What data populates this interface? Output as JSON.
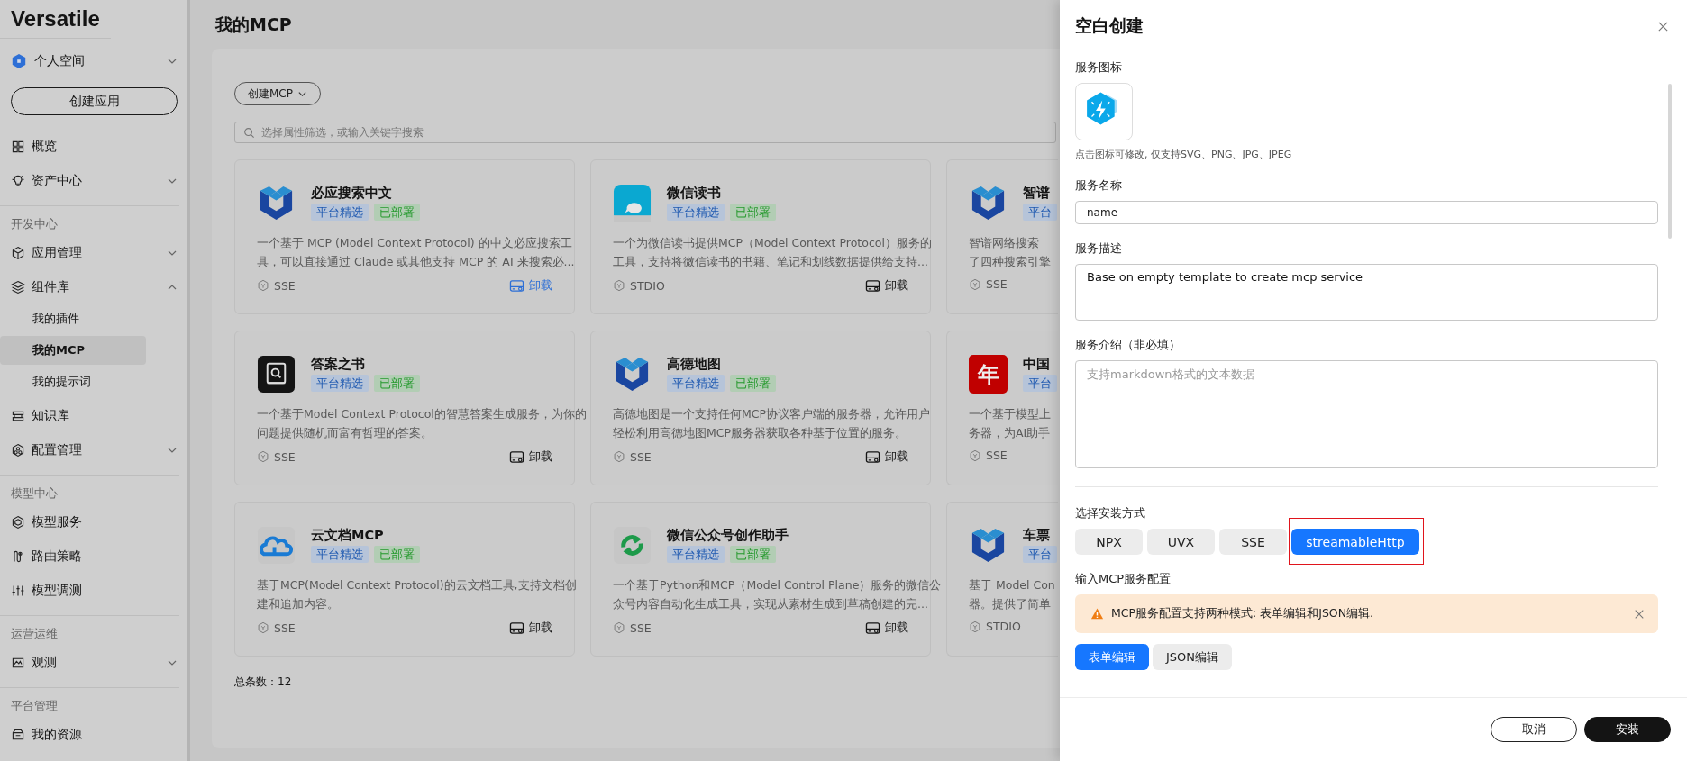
{
  "sidebar": {
    "logo": "Versatile",
    "workspace": {
      "label": "个人空间",
      "expanded": false
    },
    "create_button": "创建应用",
    "groups": [
      {
        "items": [
          {
            "label": "概览"
          },
          {
            "label": "资产中心",
            "expanded": false
          }
        ]
      },
      {
        "heading": "开发中心",
        "items": [
          {
            "label": "应用管理",
            "expanded": false
          },
          {
            "label": "组件库",
            "expanded": true,
            "children": [
              {
                "label": "我的插件",
                "selected": false
              },
              {
                "label": "我的MCP",
                "selected": true
              },
              {
                "label": "我的提示词",
                "selected": false
              }
            ]
          },
          {
            "label": "知识库"
          },
          {
            "label": "配置管理",
            "expanded": false
          }
        ]
      },
      {
        "heading": "模型中心",
        "items": [
          {
            "label": "模型服务"
          },
          {
            "label": "路由策略"
          },
          {
            "label": "模型调测"
          }
        ]
      },
      {
        "heading": "运营运维",
        "items": [
          {
            "label": "观测",
            "expanded": false
          }
        ]
      },
      {
        "heading": "平台管理",
        "items": [
          {
            "label": "我的资源"
          }
        ]
      }
    ]
  },
  "page": {
    "title": "我的MCP",
    "create_button": "创建MCP",
    "search": {
      "placeholder": "选择属性筛选，或输入关键字搜索"
    },
    "cards": [
      {
        "title": "必应搜索中文",
        "tags": [
          {
            "label": "平台精选",
            "color": "#b6c4d9"
          },
          {
            "label": "已部署",
            "color": "#b2cdb4"
          }
        ],
        "description": [
          "一个基于 MCP (Model Context Protocol) 的中文必应搜索工",
          "具，可以直接通过 Claude 或其他支持 MCP 的 AI 来搜索必..."
        ],
        "transport": "SSE",
        "action": {
          "label": "卸载",
          "highlighted": true
        }
      },
      {
        "title": "微信读书",
        "tags": [
          {
            "label": "平台精选",
            "color": "#b6c4d9"
          },
          {
            "label": "已部署",
            "color": "#b2cdb4"
          }
        ],
        "description": [
          "一个为微信读书提供MCP（Model Context Protocol）服务的",
          "工具，支持将微信读书的书籍、笔记和划线数据提供给支持..."
        ],
        "transport": "STDIO",
        "action": {
          "label": "卸载",
          "highlighted": false
        }
      },
      {
        "title": "智谱",
        "tags": [
          {
            "label": "平台",
            "color": "#b6c4d9"
          }
        ],
        "description": [
          "智谱网络搜索",
          "了四种搜索引擎"
        ],
        "transport": "SSE"
      },
      {
        "title": "答案之书",
        "tags": [
          {
            "label": "平台精选",
            "color": "#b6c4d9"
          },
          {
            "label": "已部署",
            "color": "#b2cdb4"
          }
        ],
        "description": [
          "一个基于Model Context Protocol的智慧答案生成服务，为你的",
          "问题提供随机而富有哲理的答案。"
        ],
        "transport": "SSE",
        "action": {
          "label": "卸载",
          "highlighted": false
        }
      },
      {
        "title": "高德地图",
        "tags": [
          {
            "label": "平台精选",
            "color": "#b6c4d9"
          },
          {
            "label": "已部署",
            "color": "#b2cdb4"
          }
        ],
        "description": [
          "高德地图是一个支持任何MCP协议客户端的服务器，允许用户",
          "轻松利用高德地图MCP服务器获取各种基于位置的服务。"
        ],
        "transport": "SSE",
        "action": {
          "label": "卸载",
          "highlighted": false
        }
      },
      {
        "title": "中国",
        "icon_text": "年",
        "tags": [
          {
            "label": "平台",
            "color": "#b6c4d9"
          }
        ],
        "description": [
          "一个基于模型上",
          "务器，为AI助手"
        ],
        "transport": "SSE"
      },
      {
        "title": "云文档MCP",
        "tags": [
          {
            "label": "平台精选",
            "color": "#b6c4d9"
          },
          {
            "label": "已部署",
            "color": "#b2cdb4"
          }
        ],
        "description": [
          "基于MCP(Model Context Protocol)的云文档工具,支持文档创",
          "建和追加内容。"
        ],
        "transport": "SSE",
        "action": {
          "label": "卸载",
          "highlighted": false
        }
      },
      {
        "title": "微信公众号创作助手",
        "tags": [
          {
            "label": "平台精选",
            "color": "#b6c4d9"
          },
          {
            "label": "已部署",
            "color": "#b2cdb4"
          }
        ],
        "description": [
          "一个基于Python和MCP（Model Control Plane）服务的微信公",
          "众号内容自动化生成工具，实现从素材生成到草稿创建的完..."
        ],
        "transport": "SSE",
        "action": {
          "label": "卸载",
          "highlighted": false
        }
      },
      {
        "title": "车票",
        "tags": [
          {
            "label": "平台",
            "color": "#b6c4d9"
          }
        ],
        "description": [
          "基于 Model Con",
          "器。提供了简单"
        ],
        "transport": "STDIO"
      }
    ],
    "total": "总条数：12"
  },
  "drawer": {
    "title": "空白创建",
    "icon_label": "服务图标",
    "icon_hint": "点击图标可修改, 仅支持SVG、PNG、JPG、JPEG",
    "name_label": "服务名称",
    "name_value": "name",
    "desc_label": "服务描述",
    "desc_value": "Base on empty template to create mcp service",
    "intro_label": "服务介绍（非必填）",
    "intro_placeholder": "支持markdown格式的文本数据",
    "install_label": "选择安装方式",
    "install_options": [
      {
        "label": "NPX",
        "selected": false
      },
      {
        "label": "UVX",
        "selected": false
      },
      {
        "label": "SSE",
        "selected": false
      },
      {
        "label": "streamableHttp",
        "selected": true,
        "highlighted": true
      }
    ],
    "config_label": "输入MCP服务配置",
    "alert": "MCP服务配置支持两种模式: 表单编辑和JSON编辑.",
    "modes": [
      {
        "label": "表单编辑",
        "selected": true
      },
      {
        "label": "JSON编辑",
        "selected": false
      }
    ],
    "buttons": [
      {
        "label": "取消",
        "kind": "secondary"
      },
      {
        "label": "安装",
        "kind": "primary"
      }
    ]
  }
}
